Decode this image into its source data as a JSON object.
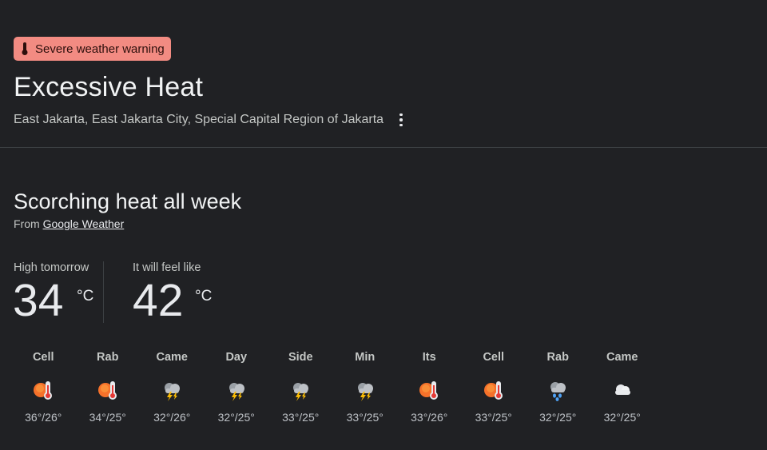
{
  "alert": {
    "badge_label": "Severe weather warning",
    "badge_icon": "thermometer-icon",
    "badge_color": "#f28b82",
    "title": "Excessive Heat",
    "location": "East Jakarta, East Jakarta City, Special Capital Region of Jakarta",
    "menu_icon": "more-vert-icon"
  },
  "summary": {
    "heading": "Scorching heat all week",
    "source_prefix": "From",
    "source_link": "Google Weather"
  },
  "stats": {
    "high_label": "High tomorrow",
    "high_value": "34",
    "high_unit": "°C",
    "feel_label": "It will feel like",
    "feel_value": "42",
    "feel_unit": "°C"
  },
  "forecast": [
    {
      "day": "Cell",
      "icon": "hot-thermometer-icon",
      "temp": "36°/26°"
    },
    {
      "day": "Rab",
      "icon": "hot-thermometer-icon",
      "temp": "34°/25°"
    },
    {
      "day": "Came",
      "icon": "thunderstorm-icon",
      "temp": "32°/26°"
    },
    {
      "day": "Day",
      "icon": "thunderstorm-icon",
      "temp": "32°/25°"
    },
    {
      "day": "Side",
      "icon": "thunderstorm-icon",
      "temp": "33°/25°"
    },
    {
      "day": "Min",
      "icon": "thunderstorm-icon",
      "temp": "33°/25°"
    },
    {
      "day": "Its",
      "icon": "hot-thermometer-icon",
      "temp": "33°/26°"
    },
    {
      "day": "Cell",
      "icon": "hot-thermometer-icon",
      "temp": "33°/25°"
    },
    {
      "day": "Rab",
      "icon": "rain-cloud-icon",
      "temp": "32°/25°"
    },
    {
      "day": "Came",
      "icon": "cloud-icon",
      "temp": "32°/25°"
    }
  ]
}
